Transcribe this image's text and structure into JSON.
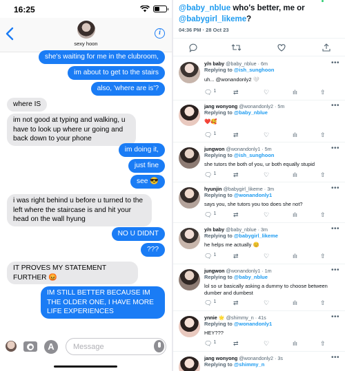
{
  "status_bar": {
    "time": "16:25"
  },
  "conversation": {
    "contact_name": "sexy hoon"
  },
  "messages": [
    {
      "dir": "out",
      "text": "she's waiting for me in the clubroom,"
    },
    {
      "dir": "out",
      "text": "im about to get to the stairs"
    },
    {
      "dir": "out",
      "text": "also, 'where are is'?"
    },
    {
      "dir": "in",
      "text": "where IS"
    },
    {
      "dir": "in",
      "text": "im not good at typing and walking, u have to look up where ur going and back down to your phone"
    },
    {
      "dir": "out",
      "text": "im doing it,"
    },
    {
      "dir": "out",
      "text": "just fine"
    },
    {
      "dir": "out",
      "text": "see 😎"
    },
    {
      "dir": "in",
      "text": "i was right behind u before u turned to the left where the staircase is and hit your head on the wall hyung"
    },
    {
      "dir": "out",
      "text": "NO U DIDNT"
    },
    {
      "dir": "out",
      "text": "???"
    },
    {
      "dir": "in",
      "text": "IT PROVES MY STATEMENT FURTHER 😡"
    },
    {
      "dir": "out",
      "text": "IM STILL BETTER BECAUSE IM THE OLDER ONE, I HAVE MORE LIFE EXPERIENCES"
    }
  ],
  "composer": {
    "placeholder": "Message"
  },
  "tweet": {
    "mention_1": "@baby_nblue",
    "middle": " who's better, me or ",
    "mention_2": "@babygirl_likeme",
    "end": "?",
    "timestamp": "04:36 PM · 28 Oct 23"
  },
  "replies": [
    {
      "name": "y/n baby",
      "handle": "@baby_nblue",
      "time": "6m",
      "replying_to": "@ish_sunghoon",
      "text": "uh... @wonandonly2 🤍",
      "replies": "1"
    },
    {
      "name": "jang wonyong",
      "handle": "@wonandonly2",
      "time": "5m",
      "replying_to": "@baby_nblue",
      "text": "❤️🥰",
      "replies": "1"
    },
    {
      "name": "jungwon",
      "handle": "@wonandonly1",
      "time": "5m",
      "replying_to": "@ish_sunghoon",
      "text": "she tutors the both of you, ur both equally stupid",
      "replies": "1"
    },
    {
      "name": "hyunjin",
      "handle": "@babygirl_likeme",
      "time": "3m",
      "replying_to": "@wonandonly1",
      "text": "says you, she tutors you too does she not?",
      "replies": "1"
    },
    {
      "name": "y/n baby",
      "handle": "@baby_nblue",
      "time": "3m",
      "replying_to": "@babygirl_likeme",
      "text": "he helps me actually 😊",
      "replies": "1"
    },
    {
      "name": "jungwon",
      "handle": "@wonandonly1",
      "time": "1m",
      "replying_to": "@baby_nblue",
      "text": "lol so ur basically asking a dummy to choose between dumber and dumbest",
      "replies": "1"
    },
    {
      "name": "ynnie 🌟",
      "handle": "@shimmy_n",
      "time": "41s",
      "replying_to": "@wonandonly1",
      "text": "HEY???",
      "replies": "1"
    },
    {
      "name": "jang wonyong",
      "handle": "@wonandonly2",
      "time": "3s",
      "replying_to": "@shimmy_n",
      "text": "",
      "replies": ""
    }
  ]
}
